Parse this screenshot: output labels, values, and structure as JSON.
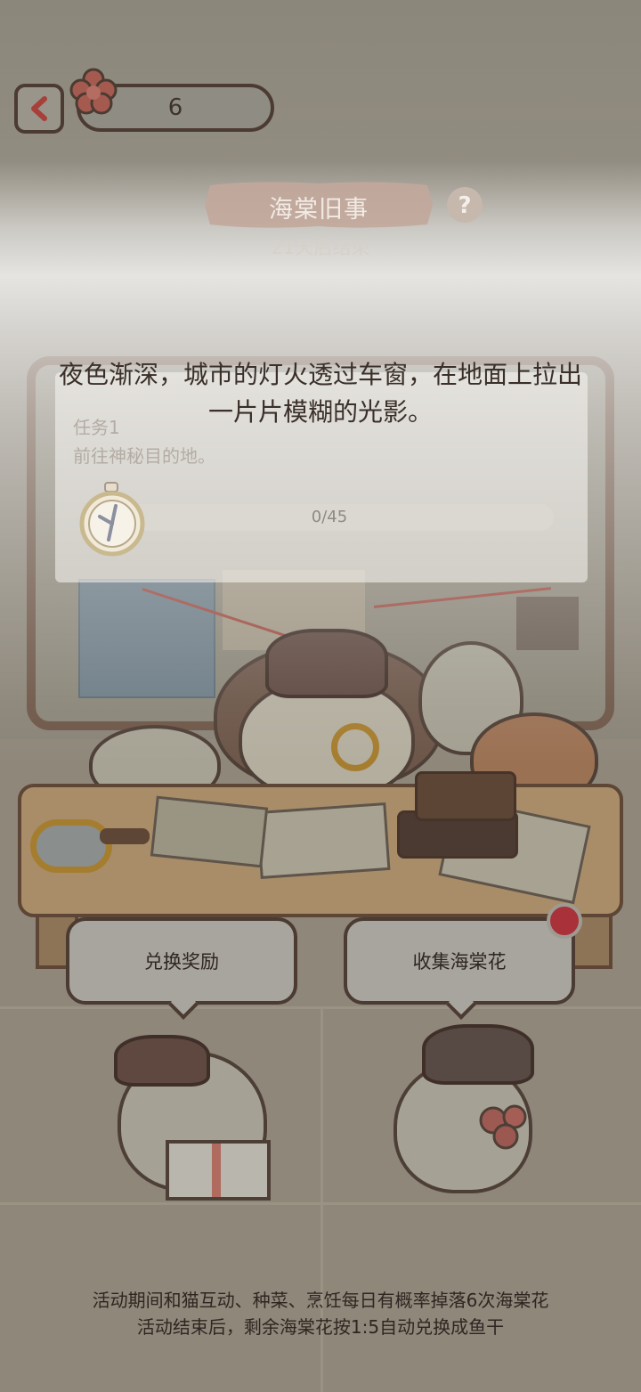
{
  "top_bar": {
    "flower_count": "6"
  },
  "event": {
    "title": "海棠旧事",
    "countdown": "21天后结束"
  },
  "narrative": {
    "line1": "夜色渐深，城市的灯火透过车窗，在地面上拉出",
    "line2": "一片片模糊的光影。"
  },
  "task": {
    "label": "任务1",
    "description": "前往神秘目的地。",
    "progress_text": "0/45",
    "progress_fraction": 0
  },
  "actions": {
    "exchange_label": "兑换奖励",
    "collect_label": "收集海棠花"
  },
  "footer": {
    "line1": "活动期间和猫互动、种菜、烹饪每日有概率掉落6次海棠花",
    "line2": "活动结束后，剩余海棠花按1:5自动兑换成鱼干"
  },
  "colors": {
    "accent_red": "#c44a3f",
    "notification_dot": "#a8313a",
    "banner": "#8a5e4a"
  },
  "icons": [
    "back-arrow-icon",
    "begonia-flower-icon",
    "help-icon",
    "compass-icon",
    "magnifier-icon"
  ]
}
